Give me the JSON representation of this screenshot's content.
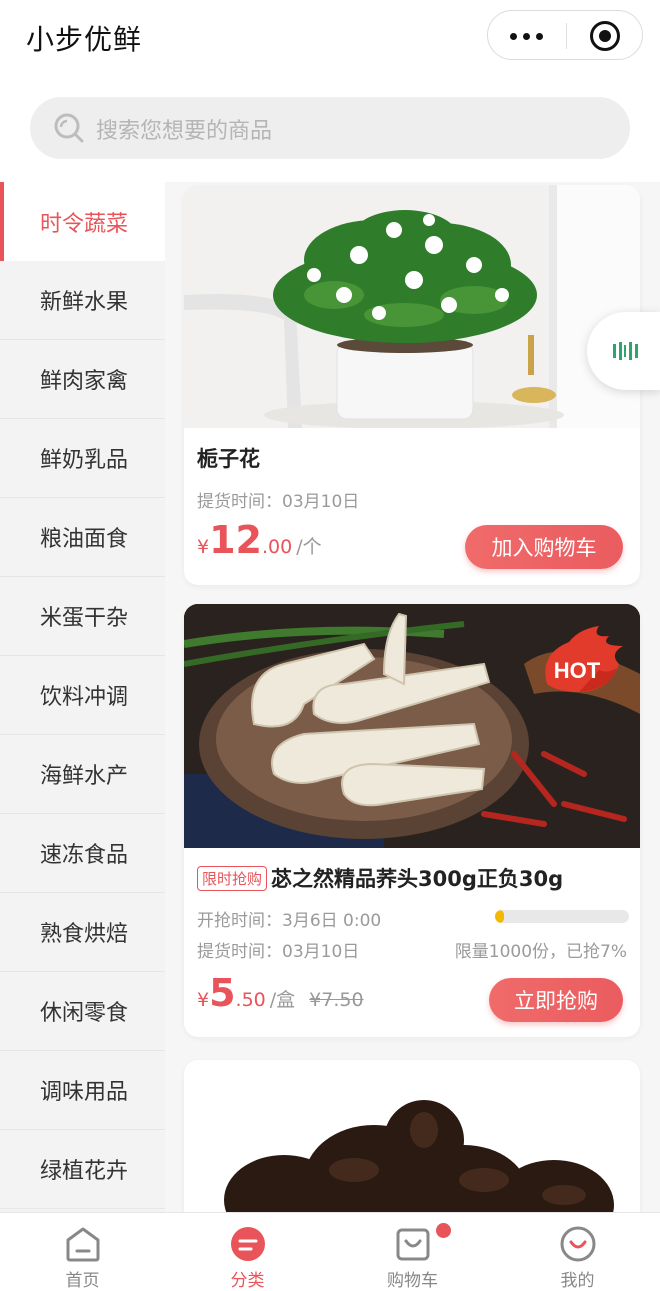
{
  "header": {
    "title": "小步优鲜"
  },
  "search": {
    "placeholder": "搜索您想要的商品"
  },
  "sidebar": {
    "items": [
      {
        "label": "时令蔬菜",
        "active": true
      },
      {
        "label": "新鲜水果"
      },
      {
        "label": "鲜肉家禽"
      },
      {
        "label": "鲜奶乳品"
      },
      {
        "label": "粮油面食"
      },
      {
        "label": "米蛋干杂"
      },
      {
        "label": "饮料冲调"
      },
      {
        "label": "海鲜水产"
      },
      {
        "label": "速冻食品"
      },
      {
        "label": "熟食烘焙"
      },
      {
        "label": "休闲零食"
      },
      {
        "label": "调味用品"
      },
      {
        "label": "绿植花卉"
      }
    ]
  },
  "products": [
    {
      "name": "栀子花",
      "pickup": "提货时间：03月10日",
      "price": {
        "yen": "¥",
        "int": "12",
        "dec": ".00",
        "unit": "/个"
      },
      "button": "加入购物车"
    },
    {
      "badge": "限时抢购",
      "name": "苾之然精品荞头300g正负30g",
      "start": "开抢时间：3月6日 0:00",
      "pickup": "提货时间：03月10日",
      "limit": "限量1000份，已抢7%",
      "sold_fraction": 0.07,
      "hot": "HOT",
      "price": {
        "yen": "¥",
        "int": "5",
        "dec": ".50",
        "unit": "/盒",
        "original": "¥7.50"
      },
      "button": "立即抢购"
    }
  ],
  "tabbar": {
    "items": [
      {
        "label": "首页"
      },
      {
        "label": "分类",
        "active": true
      },
      {
        "label": "购物车"
      },
      {
        "label": "我的"
      }
    ]
  },
  "colors": {
    "accent": "#e8545a",
    "progress": "#f5b800",
    "sidebar_bg": "#f3f3f3"
  }
}
